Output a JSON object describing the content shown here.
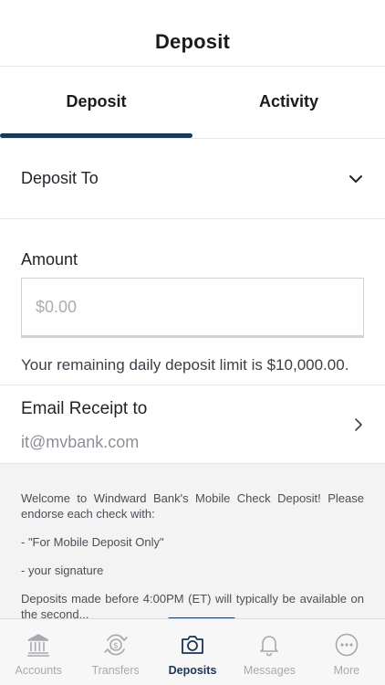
{
  "header": {
    "title": "Deposit"
  },
  "tabs": [
    {
      "label": "Deposit",
      "active": true
    },
    {
      "label": "Activity",
      "active": false
    }
  ],
  "deposit_to": {
    "label": "Deposit To",
    "icon": "chevron-down-icon"
  },
  "amount": {
    "label": "Amount",
    "placeholder": "$0.00"
  },
  "limit_text": "Your remaining daily deposit limit is $10,000.00.",
  "email_receipt": {
    "label": "Email Receipt to",
    "value": "it@mvbank.com",
    "icon": "chevron-right-icon"
  },
  "info": {
    "paragraphs": [
      "Welcome to Windward Bank's Mobile Check Deposit! Please endorse each check with:",
      "- \"For Mobile Deposit Only\"",
      "- your signature",
      "Deposits made before 4:00PM (ET) will typically be available on the second..."
    ]
  },
  "bottom_nav": [
    {
      "label": "Accounts",
      "icon": "bank-icon",
      "active": false
    },
    {
      "label": "Transfers",
      "icon": "transfer-icon",
      "active": false
    },
    {
      "label": "Deposits",
      "icon": "camera-icon",
      "active": true
    },
    {
      "label": "Messages",
      "icon": "bell-icon",
      "active": false
    },
    {
      "label": "More",
      "icon": "more-icon",
      "active": false
    }
  ],
  "colors": {
    "accent": "#163a5c",
    "nav_inactive": "#a6a9ae",
    "panel_bg": "#f3f3f4"
  }
}
